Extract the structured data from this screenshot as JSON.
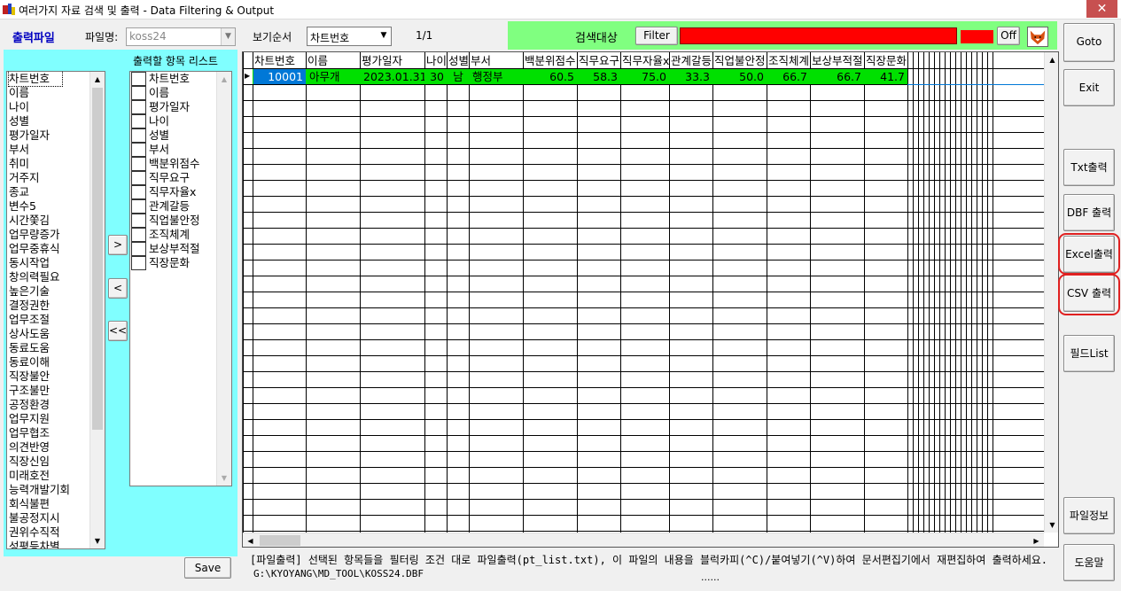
{
  "window": {
    "title": "여러가지 자료 검색 및 출력 - Data Filtering & Output",
    "close_label": "✕"
  },
  "toolbar": {
    "output_file_label": "출력파일",
    "filename_label": "파일명:",
    "filename_value": "koss24",
    "view_order_label": "보기순서",
    "view_order_value": "차트번호",
    "page_indicator": "1/1"
  },
  "search": {
    "label": "검색대상",
    "filter_button": "Filter",
    "off_button": "Off",
    "filter_bar_color": "#ff0000",
    "panel_color": "#80ff80"
  },
  "left_panel": {
    "background": "#80ffff",
    "output_list_label": "출력할 항목 리스트",
    "fields": [
      "차트번호",
      "이름",
      "나이",
      "성별",
      "평가일자",
      "부서",
      "취미",
      "거주지",
      "종교",
      "변수5",
      "시간쫓김",
      "업무량증가",
      "업무중휴식",
      "동시작업",
      "창의력필요",
      "높은기술",
      "결정권한",
      "업무조절",
      "상사도움",
      "동료도움",
      "동료이해",
      "직장불안",
      "구조불만",
      "공정환경",
      "업무지원",
      "업무협조",
      "의견반영",
      "직장신임",
      "미래호전",
      "능력개발기회",
      "회식불편",
      "불공정지시",
      "권위수직적",
      "성평등차별"
    ],
    "output_items": [
      "차트번호",
      "이름",
      "평가일자",
      "나이",
      "성별",
      "부서",
      "백분위점수",
      "직무요구",
      "직무자율x",
      "관계갈등",
      "직업불안정",
      "조직체계",
      "보상부적절",
      "직장문화"
    ],
    "move_right_label": ">",
    "move_left_label": "<",
    "move_all_left_label": "<<",
    "save_label": "Save"
  },
  "grid": {
    "columns": [
      "차트번호",
      "이름",
      "평가일자",
      "나이",
      "성별",
      "부서",
      "백분위점수",
      "직무요구",
      "직무자율x",
      "관계갈등",
      "직업불안정",
      "조직체계",
      "보상부적절",
      "직장문화"
    ],
    "row": [
      "10001",
      "아무개",
      "2023.01.31",
      "30",
      "남",
      "행정부",
      "60.5",
      "58.3",
      "75.0",
      "33.3",
      "50.0",
      "66.7",
      "66.7",
      "41.7"
    ],
    "row_color": "#00e000",
    "selected_color": "#0078d7"
  },
  "status": {
    "hint": "[파일출력] 선택된 항목들을 필터링 조건 대로 파일출력(pt_list.txt), 이 파일의 내용을 블럭카피(^C)/붙여넣기(^V)하여 문서편집기에서 재편집하여 출력하세요.",
    "path": "G:\\KYOYANG\\MD_TOOL\\KOSS24.DBF",
    "dots": "......"
  },
  "right_buttons": {
    "goto": "Goto",
    "exit": "Exit",
    "txt_output": "Txt출력",
    "dbf_output": "DBF 출력",
    "excel_output": "Excel출력",
    "csv_output": "CSV 출력",
    "field_list": "필드List",
    "file_info": "파일정보",
    "help": "도움말",
    "highlight_color": "#e02020"
  }
}
